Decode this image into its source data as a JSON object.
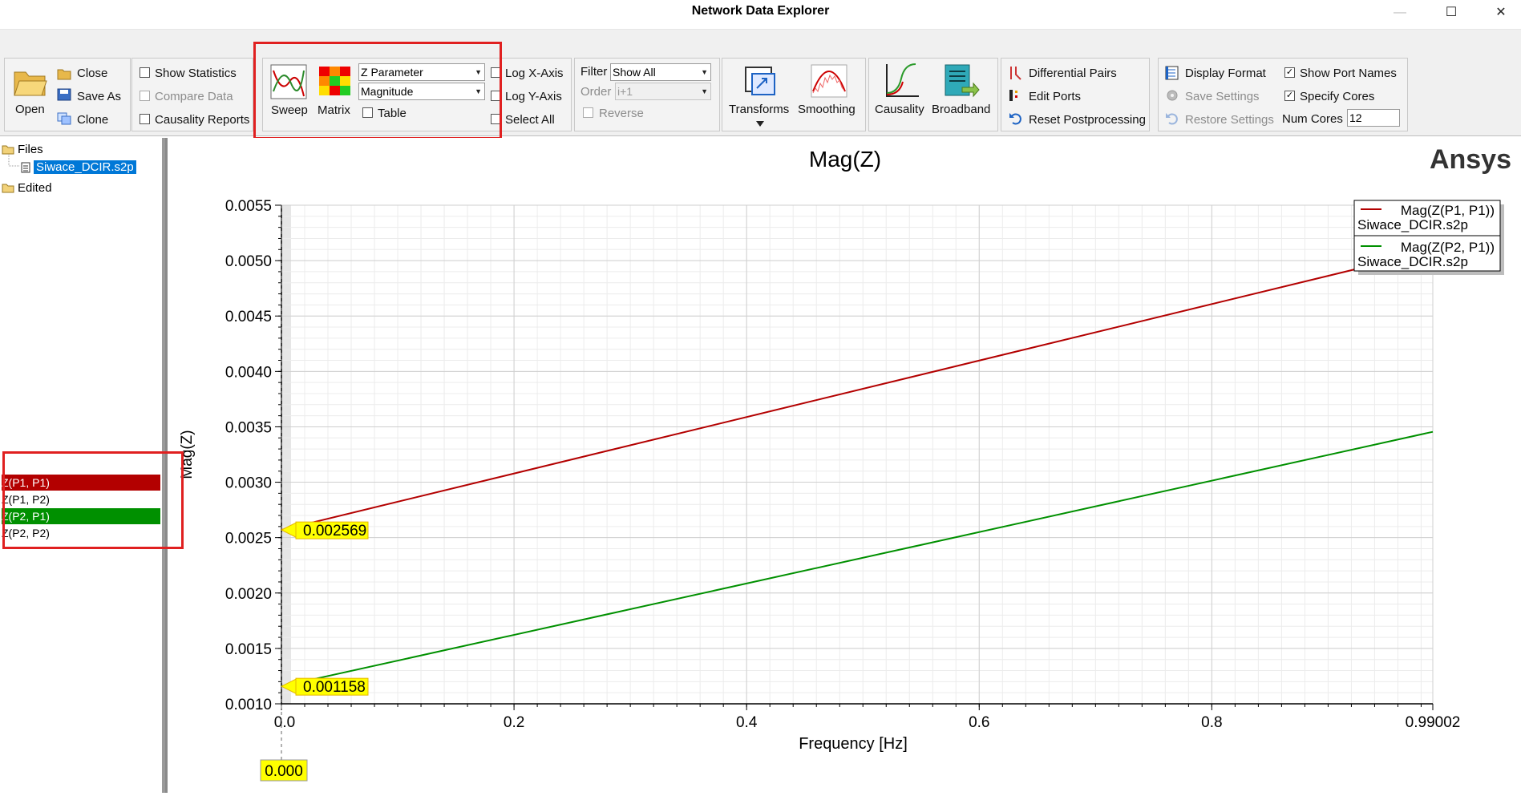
{
  "window": {
    "title": "Network Data Explorer",
    "minimize": "—",
    "maximize": "☐",
    "close": "✕"
  },
  "ribbon": {
    "open": "Open",
    "close": "Close",
    "save_as": "Save As",
    "clone": "Clone",
    "show_statistics": "Show Statistics",
    "compare_data": "Compare Data",
    "causality_reports": "Causality Reports",
    "sweep": "Sweep",
    "matrix": "Matrix",
    "parameter_select": "Z Parameter",
    "format_select": "Magnitude",
    "table": "Table",
    "log_x": "Log X-Axis",
    "log_y": "Log Y-Axis",
    "select_all": "Select All",
    "filter_label": "Filter",
    "filter_value": "Show All",
    "order_label": "Order",
    "order_value": "i+1",
    "reverse": "Reverse",
    "transforms": "Transforms",
    "smoothing": "Smoothing",
    "causality": "Causality",
    "broadband": "Broadband",
    "differential_pairs": "Differential Pairs",
    "edit_ports": "Edit Ports",
    "reset_postprocessing": "Reset Postprocessing",
    "display_format": "Display Format",
    "save_settings": "Save Settings",
    "restore_settings": "Restore Settings",
    "show_port_names": "Show Port Names",
    "specify_cores": "Specify Cores",
    "num_cores_label": "Num Cores",
    "num_cores_value": "12"
  },
  "tree": {
    "files": "Files",
    "file": "Siwace_DCIR.s2p",
    "edited": "Edited"
  },
  "traces": [
    {
      "label": "Z(P1, P1)",
      "color": "#b30000",
      "selected": true
    },
    {
      "label": "Z(P1, P2)",
      "color": "",
      "selected": false
    },
    {
      "label": "Z(P2, P1)",
      "color": "#009000",
      "selected": true
    },
    {
      "label": "Z(P2, P2)",
      "color": "",
      "selected": false
    }
  ],
  "chart_data": {
    "type": "line",
    "title": "Mag(Z)",
    "brand": "Ansys",
    "xlabel": "Frequency [Hz]",
    "ylabel": "Mag(Z)",
    "xlim": [
      0,
      0.99002
    ],
    "ylim": [
      0.001,
      0.0055
    ],
    "x_ticks": [
      "0.0",
      "0.2",
      "0.4",
      "0.6",
      "0.8",
      "0.99002"
    ],
    "x_tick_values": [
      0,
      0.2,
      0.4,
      0.6,
      0.8,
      0.99002
    ],
    "y_ticks": [
      "0.0055",
      "0.0050",
      "0.0045",
      "0.0040",
      "0.0035",
      "0.0030",
      "0.0025",
      "0.0020",
      "0.0015",
      "0.0010"
    ],
    "y_tick_values": [
      0.0055,
      0.005,
      0.0045,
      0.004,
      0.0035,
      0.003,
      0.0025,
      0.002,
      0.0015,
      0.001
    ],
    "grid": true,
    "legend_position": "top-right",
    "series": [
      {
        "name": "Mag(Z(P1, P1))",
        "file": "Siwace_DCIR.s2p",
        "color": "#b30000",
        "x": [
          0,
          0.99002
        ],
        "y": [
          0.002569,
          0.005092
        ]
      },
      {
        "name": "Mag(Z(P2, P1))",
        "file": "Siwace_DCIR.s2p",
        "color": "#009000",
        "x": [
          0,
          0.99002
        ],
        "y": [
          0.001158,
          0.003455
        ]
      }
    ],
    "markers": [
      {
        "series": 0,
        "label": "0.002569"
      },
      {
        "series": 1,
        "label": "0.001158"
      }
    ],
    "cursor_label": "0.000"
  }
}
